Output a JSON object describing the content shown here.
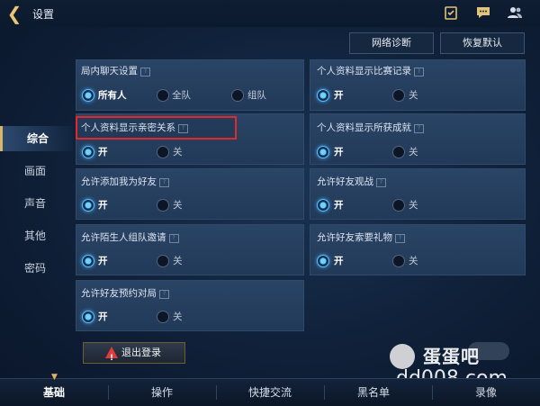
{
  "header": {
    "title": "设置"
  },
  "top_buttons": {
    "network": "网络诊断",
    "restore": "恢复默认"
  },
  "sidebar": {
    "items": [
      {
        "label": "综合",
        "active": true
      },
      {
        "label": "画面"
      },
      {
        "label": "声音"
      },
      {
        "label": "其他"
      },
      {
        "label": "密码"
      }
    ]
  },
  "settings": {
    "chat": {
      "label": "局内聊天设置",
      "options": [
        "所有人",
        "全队",
        "组队"
      ],
      "selected": "所有人"
    },
    "match_record": {
      "label": "个人资料显示比赛记录",
      "on": "开",
      "off": "关",
      "selected": "开"
    },
    "intimacy": {
      "label": "个人资料显示亲密关系",
      "on": "开",
      "off": "关",
      "selected": "开"
    },
    "achievements": {
      "label": "个人资料显示所获成就",
      "on": "开",
      "off": "关",
      "selected": "开"
    },
    "add_friend": {
      "label": "允许添加我为好友",
      "on": "开",
      "off": "关",
      "selected": "开"
    },
    "spectate": {
      "label": "允许好友观战",
      "on": "开",
      "off": "关",
      "selected": "开"
    },
    "stranger_invite": {
      "label": "允许陌生人组队邀请",
      "on": "开",
      "off": "关",
      "selected": "开"
    },
    "gift_request": {
      "label": "允许好友索要礼物",
      "on": "开",
      "off": "关",
      "selected": "开"
    },
    "reservation": {
      "label": "允许好友预约对局",
      "on": "开",
      "off": "关",
      "selected": "开"
    }
  },
  "logout": {
    "label": "退出登录"
  },
  "bottom_tabs": [
    "基础",
    "操作",
    "快捷交流",
    "黑名单",
    "录像"
  ],
  "watermark": {
    "site_name": "蛋蛋吧",
    "url": "dd008.com"
  },
  "colors": {
    "accent": "#5fc0ff",
    "gold": "#d9b56a",
    "highlight": "#e5262b"
  }
}
